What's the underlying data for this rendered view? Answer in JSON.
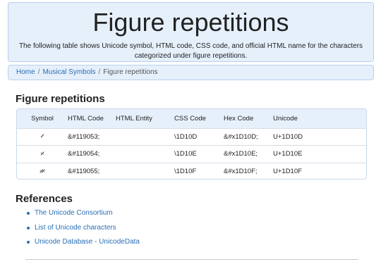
{
  "hero": {
    "title": "Figure repetitions",
    "description": "The following table shows Unicode symbol, HTML code, CSS code, and official HTML name for the characters categorized under figure repetitions."
  },
  "breadcrumb": {
    "items": [
      "Home",
      "Musical Symbols",
      "Figure repetitions"
    ]
  },
  "section_title": "Figure repetitions",
  "table": {
    "headers": [
      "Symbol",
      "HTML Code",
      "HTML Entity",
      "CSS Code",
      "Hex Code",
      "Unicode"
    ],
    "rows": [
      {
        "symbol": "𝄍",
        "html_code": "&#119053;",
        "html_entity": "",
        "css_code": "\\1D10D",
        "hex_code": "&#x1D10D;",
        "unicode": "U+1D10D"
      },
      {
        "symbol": "𝄎",
        "html_code": "&#119054;",
        "html_entity": "",
        "css_code": "\\1D10E",
        "hex_code": "&#x1D10E;",
        "unicode": "U+1D10E"
      },
      {
        "symbol": "𝄏",
        "html_code": "&#119055;",
        "html_entity": "",
        "css_code": "\\1D10F",
        "hex_code": "&#x1D10F;",
        "unicode": "U+1D10F"
      }
    ]
  },
  "references": {
    "title": "References",
    "items": [
      "The Unicode Consortium",
      "List of Unicode characters",
      "Unicode Database - UnicodeData"
    ]
  },
  "colors": {
    "accent": "#2a6fb5",
    "panel_bg": "#e6f0fb",
    "panel_border": "#b8d0ec"
  }
}
